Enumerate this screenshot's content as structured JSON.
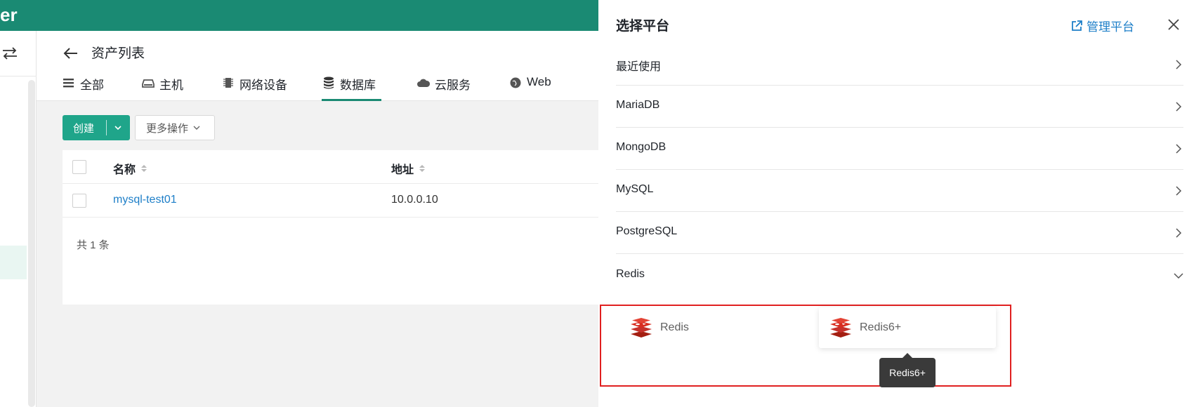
{
  "header": {
    "brand_fragment": "er"
  },
  "page": {
    "title": "资产列表"
  },
  "tabs": [
    {
      "label": "全部",
      "icon": "list-icon"
    },
    {
      "label": "主机",
      "icon": "host-icon"
    },
    {
      "label": "网络设备",
      "icon": "chip-icon"
    },
    {
      "label": "数据库",
      "icon": "database-icon",
      "active": true
    },
    {
      "label": "云服务",
      "icon": "cloud-icon"
    },
    {
      "label": "Web",
      "icon": "globe-icon"
    }
  ],
  "toolbar": {
    "create_label": "创建",
    "more_label": "更多操作"
  },
  "table": {
    "columns": {
      "name": "名称",
      "address": "地址"
    },
    "rows": [
      {
        "name": "mysql-test01",
        "address": "10.0.0.10"
      }
    ],
    "total_text": "共 1 条"
  },
  "drawer": {
    "title": "选择平台",
    "manage_label": "管理平台",
    "categories": [
      {
        "label": "最近使用",
        "expanded": false
      },
      {
        "label": "MariaDB",
        "expanded": false
      },
      {
        "label": "MongoDB",
        "expanded": false
      },
      {
        "label": "MySQL",
        "expanded": false
      },
      {
        "label": "PostgreSQL",
        "expanded": false
      },
      {
        "label": "Redis",
        "expanded": true
      }
    ],
    "redis_platforms": [
      {
        "name": "Redis"
      },
      {
        "name": "Redis6+"
      }
    ],
    "tooltip": "Redis6+"
  },
  "colors": {
    "brand_green": "#1a8a73",
    "primary_button": "#1fa58a",
    "link_blue": "#1e7fc8",
    "highlight_red": "#e02020"
  }
}
